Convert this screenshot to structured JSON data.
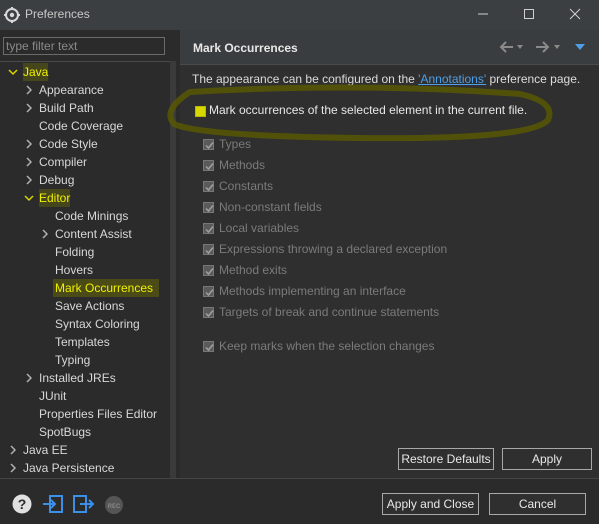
{
  "window": {
    "title": "Preferences"
  },
  "filter": {
    "placeholder": "type filter text"
  },
  "tree": [
    {
      "label": "Java",
      "indent": 0,
      "chev": "down"
    },
    {
      "label": "Appearance",
      "indent": 1,
      "chev": "right"
    },
    {
      "label": "Build Path",
      "indent": 1,
      "chev": "right"
    },
    {
      "label": "Code Coverage",
      "indent": 1,
      "chev": ""
    },
    {
      "label": "Code Style",
      "indent": 1,
      "chev": "right"
    },
    {
      "label": "Compiler",
      "indent": 1,
      "chev": "right"
    },
    {
      "label": "Debug",
      "indent": 1,
      "chev": "right"
    },
    {
      "label": "Editor",
      "indent": 1,
      "chev": "down"
    },
    {
      "label": "Code Minings",
      "indent": 2,
      "chev": ""
    },
    {
      "label": "Content Assist",
      "indent": 2,
      "chev": "right"
    },
    {
      "label": "Folding",
      "indent": 2,
      "chev": ""
    },
    {
      "label": "Hovers",
      "indent": 2,
      "chev": ""
    },
    {
      "label": "Mark Occurrences",
      "indent": 2,
      "chev": "",
      "selected": true
    },
    {
      "label": "Save Actions",
      "indent": 2,
      "chev": ""
    },
    {
      "label": "Syntax Coloring",
      "indent": 2,
      "chev": ""
    },
    {
      "label": "Templates",
      "indent": 2,
      "chev": ""
    },
    {
      "label": "Typing",
      "indent": 2,
      "chev": ""
    },
    {
      "label": "Installed JREs",
      "indent": 1,
      "chev": "right"
    },
    {
      "label": "JUnit",
      "indent": 1,
      "chev": ""
    },
    {
      "label": "Properties Files Editor",
      "indent": 1,
      "chev": ""
    },
    {
      "label": "SpotBugs",
      "indent": 1,
      "chev": ""
    },
    {
      "label": "Java EE",
      "indent": 0,
      "chev": "right"
    },
    {
      "label": "Java Persistence",
      "indent": 0,
      "chev": "right"
    }
  ],
  "page": {
    "title": "Mark Occurrences",
    "desc_before": "The appearance can be configured on the ",
    "desc_link": "'Annotations'",
    "desc_after": " preference page.",
    "main_option": "Mark occurrences of the selected element in the current file.",
    "options": [
      "Types",
      "Methods",
      "Constants",
      "Non-constant fields",
      "Local variables",
      "Expressions throwing a declared exception",
      "Method exits",
      "Methods implementing an interface",
      "Targets of break and continue statements"
    ],
    "keep_marks": "Keep marks when the selection changes"
  },
  "buttons": {
    "restore": "Restore Defaults",
    "apply": "Apply",
    "apply_close": "Apply and Close",
    "cancel": "Cancel"
  },
  "bottom_icons": [
    "help-icon",
    "import-icon",
    "export-icon",
    "record-icon"
  ],
  "colors": {
    "highlight": "#c8c800",
    "link": "#4e9fe8"
  }
}
